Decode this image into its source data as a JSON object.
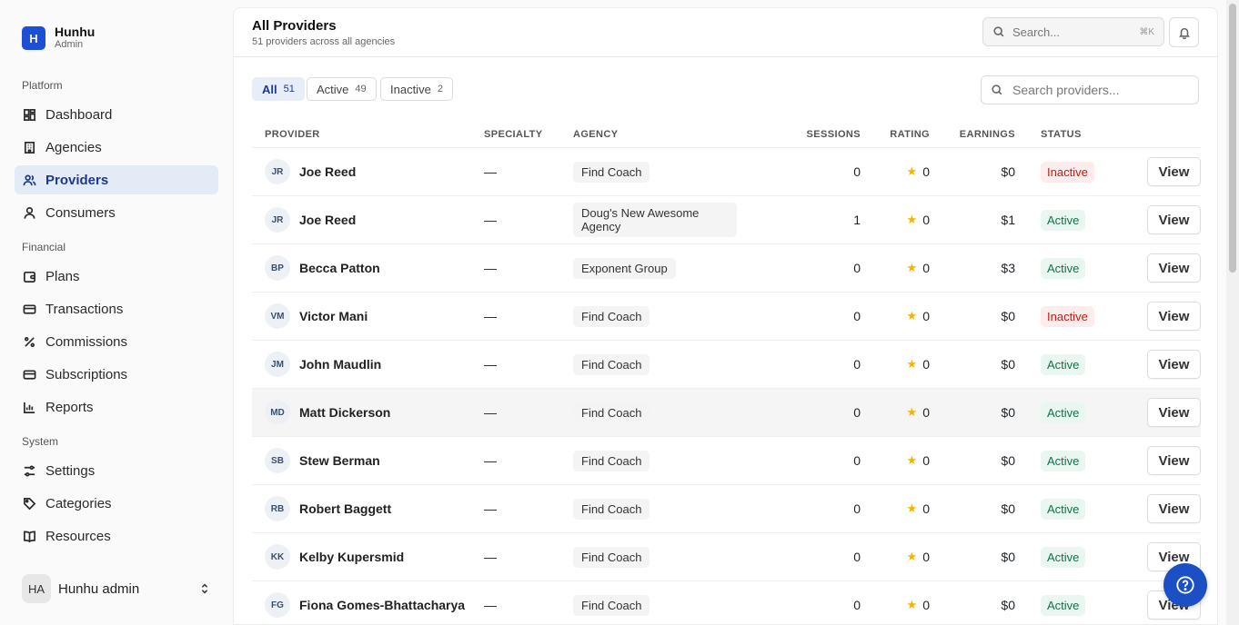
{
  "brand": {
    "logo_letter": "H",
    "name": "Hunhu",
    "subtitle": "Admin"
  },
  "sidebar": {
    "groups": [
      {
        "label": "Platform",
        "items": [
          {
            "label": "Dashboard",
            "icon": "dashboard-icon"
          },
          {
            "label": "Agencies",
            "icon": "building-icon"
          },
          {
            "label": "Providers",
            "icon": "users-icon",
            "active": true
          },
          {
            "label": "Consumers",
            "icon": "user-icon"
          }
        ]
      },
      {
        "label": "Financial",
        "items": [
          {
            "label": "Plans",
            "icon": "wallet-icon"
          },
          {
            "label": "Transactions",
            "icon": "credit-card-icon"
          },
          {
            "label": "Commissions",
            "icon": "percent-icon"
          },
          {
            "label": "Subscriptions",
            "icon": "card-icon"
          },
          {
            "label": "Reports",
            "icon": "bar-chart-icon"
          }
        ]
      },
      {
        "label": "System",
        "items": [
          {
            "label": "Settings",
            "icon": "sliders-icon"
          },
          {
            "label": "Categories",
            "icon": "tag-icon"
          },
          {
            "label": "Resources",
            "icon": "book-icon"
          }
        ]
      }
    ],
    "user": {
      "initials": "HA",
      "name": "Hunhu admin"
    }
  },
  "header": {
    "title": "All Providers",
    "subtitle": "51 providers across all agencies",
    "search_placeholder": "Search...",
    "search_shortcut": "⌘K"
  },
  "filters": {
    "tabs": [
      {
        "label": "All",
        "count": "51",
        "active": true
      },
      {
        "label": "Active",
        "count": "49"
      },
      {
        "label": "Inactive",
        "count": "2"
      }
    ],
    "search_placeholder": "Search providers..."
  },
  "table": {
    "columns": {
      "provider": "PROVIDER",
      "specialty": "SPECIALTY",
      "agency": "AGENCY",
      "sessions": "SESSIONS",
      "rating": "RATING",
      "earnings": "EARNINGS",
      "status": "STATUS"
    },
    "view_label": "View",
    "rows": [
      {
        "initials": "JR",
        "name": "Joe Reed",
        "specialty": "—",
        "agency": "Find Coach",
        "sessions": "0",
        "rating": "0",
        "earnings": "$0",
        "status": "Inactive"
      },
      {
        "initials": "JR",
        "name": "Joe Reed",
        "specialty": "—",
        "agency": "Doug's New Awesome Agency",
        "sessions": "1",
        "rating": "0",
        "earnings": "$1",
        "status": "Active"
      },
      {
        "initials": "BP",
        "name": "Becca Patton",
        "specialty": "—",
        "agency": "Exponent Group",
        "sessions": "0",
        "rating": "0",
        "earnings": "$3",
        "status": "Active"
      },
      {
        "initials": "VM",
        "name": "Victor Mani",
        "specialty": "—",
        "agency": "Find Coach",
        "sessions": "0",
        "rating": "0",
        "earnings": "$0",
        "status": "Inactive"
      },
      {
        "initials": "JM",
        "name": "John Maudlin",
        "specialty": "—",
        "agency": "Find Coach",
        "sessions": "0",
        "rating": "0",
        "earnings": "$0",
        "status": "Active"
      },
      {
        "initials": "MD",
        "name": "Matt Dickerson",
        "specialty": "—",
        "agency": "Find Coach",
        "sessions": "0",
        "rating": "0",
        "earnings": "$0",
        "status": "Active"
      },
      {
        "initials": "SB",
        "name": "Stew Berman",
        "specialty": "—",
        "agency": "Find Coach",
        "sessions": "0",
        "rating": "0",
        "earnings": "$0",
        "status": "Active"
      },
      {
        "initials": "RB",
        "name": "Robert Baggett",
        "specialty": "—",
        "agency": "Find Coach",
        "sessions": "0",
        "rating": "0",
        "earnings": "$0",
        "status": "Active"
      },
      {
        "initials": "KK",
        "name": "Kelby Kupersmid",
        "specialty": "—",
        "agency": "Find Coach",
        "sessions": "0",
        "rating": "0",
        "earnings": "$0",
        "status": "Active"
      },
      {
        "initials": "FG",
        "name": "Fiona Gomes-Bhattacharya",
        "specialty": "—",
        "agency": "Find Coach",
        "sessions": "0",
        "rating": "0",
        "earnings": "$0",
        "status": "Active"
      }
    ]
  },
  "colors": {
    "accent": "#1d4ed8",
    "active_status": "#13724a",
    "inactive_status": "#b42318",
    "star": "#f5b301"
  }
}
